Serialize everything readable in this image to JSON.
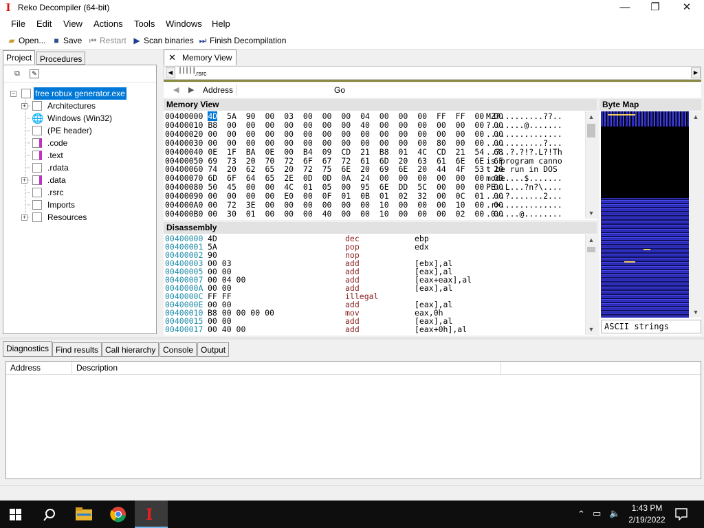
{
  "window": {
    "title": "Reko Decompiler (64-bit)",
    "minimize": "—",
    "maximize": "❐",
    "close": "✕"
  },
  "menu": [
    "File",
    "Edit",
    "View",
    "Actions",
    "Tools",
    "Windows",
    "Help"
  ],
  "toolbar": {
    "open": "Open...",
    "save": "Save",
    "restart": "Restart",
    "scan": "Scan binaries",
    "finish": "Finish Decompilation"
  },
  "left_tabs": {
    "project": "Project",
    "procedures": "Procedures"
  },
  "tree": {
    "root": "free robux generator.exe",
    "items": [
      "Architectures",
      "Windows (Win32)",
      "(PE header)",
      ".code",
      ".text",
      ".rdata",
      ".data",
      ".rsrc",
      "Imports",
      "Resources"
    ]
  },
  "doc_tab": {
    "label": "Memory View",
    "close": "✕"
  },
  "segment_label": ".rsrc",
  "nav": {
    "address_label": "Address",
    "go": "Go"
  },
  "memory_view": {
    "title": "Memory View",
    "rows": [
      {
        "addr": "00400000",
        "hex": [
          "4D",
          "5A",
          "90",
          "00",
          "03",
          "00",
          "00",
          "00",
          "04",
          "00",
          "00",
          "00",
          "FF",
          "FF",
          "00",
          "00"
        ],
        "ascii": "MZ?.........??.."
      },
      {
        "addr": "00400010",
        "hex": [
          "B8",
          "00",
          "00",
          "00",
          "00",
          "00",
          "00",
          "00",
          "40",
          "00",
          "00",
          "00",
          "00",
          "00",
          "00",
          "00"
        ],
        "ascii": "?.......@......."
      },
      {
        "addr": "00400020",
        "hex": [
          "00",
          "00",
          "00",
          "00",
          "00",
          "00",
          "00",
          "00",
          "00",
          "00",
          "00",
          "00",
          "00",
          "00",
          "00",
          "00"
        ],
        "ascii": "................"
      },
      {
        "addr": "00400030",
        "hex": [
          "00",
          "00",
          "00",
          "00",
          "00",
          "00",
          "00",
          "00",
          "00",
          "00",
          "00",
          "00",
          "80",
          "00",
          "00",
          "00"
        ],
        "ascii": "............?..."
      },
      {
        "addr": "00400040",
        "hex": [
          "0E",
          "1F",
          "BA",
          "0E",
          "00",
          "B4",
          "09",
          "CD",
          "21",
          "B8",
          "01",
          "4C",
          "CD",
          "21",
          "54",
          "68"
        ],
        "ascii": "..?..?.?!?.L?!Th"
      },
      {
        "addr": "00400050",
        "hex": [
          "69",
          "73",
          "20",
          "70",
          "72",
          "6F",
          "67",
          "72",
          "61",
          "6D",
          "20",
          "63",
          "61",
          "6E",
          "6E",
          "6F"
        ],
        "ascii": "is program canno"
      },
      {
        "addr": "00400060",
        "hex": [
          "74",
          "20",
          "62",
          "65",
          "20",
          "72",
          "75",
          "6E",
          "20",
          "69",
          "6E",
          "20",
          "44",
          "4F",
          "53",
          "20"
        ],
        "ascii": "t be run in DOS "
      },
      {
        "addr": "00400070",
        "hex": [
          "6D",
          "6F",
          "64",
          "65",
          "2E",
          "0D",
          "0D",
          "0A",
          "24",
          "00",
          "00",
          "00",
          "00",
          "00",
          "00",
          "00"
        ],
        "ascii": "mode....$......."
      },
      {
        "addr": "00400080",
        "hex": [
          "50",
          "45",
          "00",
          "00",
          "4C",
          "01",
          "05",
          "00",
          "95",
          "6E",
          "DD",
          "5C",
          "00",
          "00",
          "00",
          "00"
        ],
        "ascii": "PE..L...?n?\\...."
      },
      {
        "addr": "00400090",
        "hex": [
          "00",
          "00",
          "00",
          "00",
          "E0",
          "00",
          "0F",
          "01",
          "0B",
          "01",
          "02",
          "32",
          "00",
          "0C",
          "01",
          "00"
        ],
        "ascii": "....?.......2..."
      },
      {
        "addr": "004000A0",
        "hex": [
          "00",
          "72",
          "3E",
          "00",
          "00",
          "00",
          "00",
          "00",
          "00",
          "10",
          "00",
          "00",
          "00",
          "10",
          "00",
          "00"
        ],
        "ascii": ".r>............."
      },
      {
        "addr": "004000B0",
        "hex": [
          "00",
          "30",
          "01",
          "00",
          "00",
          "00",
          "40",
          "00",
          "00",
          "10",
          "00",
          "00",
          "00",
          "02",
          "00",
          "00"
        ],
        "ascii": ".0.....@........"
      }
    ]
  },
  "disassembly": {
    "title": "Disassembly",
    "rows": [
      {
        "addr": "00400000",
        "bytes": "4D",
        "op": "dec",
        "args": "ebp"
      },
      {
        "addr": "00400001",
        "bytes": "5A",
        "op": "pop",
        "args": "edx"
      },
      {
        "addr": "00400002",
        "bytes": "90",
        "op": "nop",
        "args": ""
      },
      {
        "addr": "00400003",
        "bytes": "00 03",
        "op": "add",
        "args": "[ebx],al"
      },
      {
        "addr": "00400005",
        "bytes": "00 00",
        "op": "add",
        "args": "[eax],al"
      },
      {
        "addr": "00400007",
        "bytes": "00 04 00",
        "op": "add",
        "args": "[eax+eax],al"
      },
      {
        "addr": "0040000A",
        "bytes": "00 00",
        "op": "add",
        "args": "[eax],al"
      },
      {
        "addr": "0040000C",
        "bytes": "FF FF",
        "op": "illegal",
        "args": ""
      },
      {
        "addr": "0040000E",
        "bytes": "00 00",
        "op": "add",
        "args": "[eax],al"
      },
      {
        "addr": "00400010",
        "bytes": "B8 00 00 00 00",
        "op": "mov",
        "args": "eax,0h"
      },
      {
        "addr": "00400015",
        "bytes": "00 00",
        "op": "add",
        "args": "[eax],al"
      },
      {
        "addr": "00400017",
        "bytes": "00 40 00",
        "op": "add",
        "args": "[eax+0h],al"
      }
    ]
  },
  "byte_map": {
    "title": "Byte Map",
    "select_value": "ASCII strings"
  },
  "bottom_tabs": [
    "Diagnostics",
    "Find results",
    "Call hierarchy",
    "Console",
    "Output"
  ],
  "diagnostics": {
    "columns": [
      "Address",
      "Description"
    ]
  },
  "taskbar": {
    "time": "1:43 PM",
    "date": "2/19/2022"
  },
  "colors": {
    "selection": "#0078d7",
    "address": "#1b8aa8",
    "opcode": "#8b1f1f",
    "bytemap": "#3a3ad0",
    "taskbar": "#0e0e0e"
  }
}
